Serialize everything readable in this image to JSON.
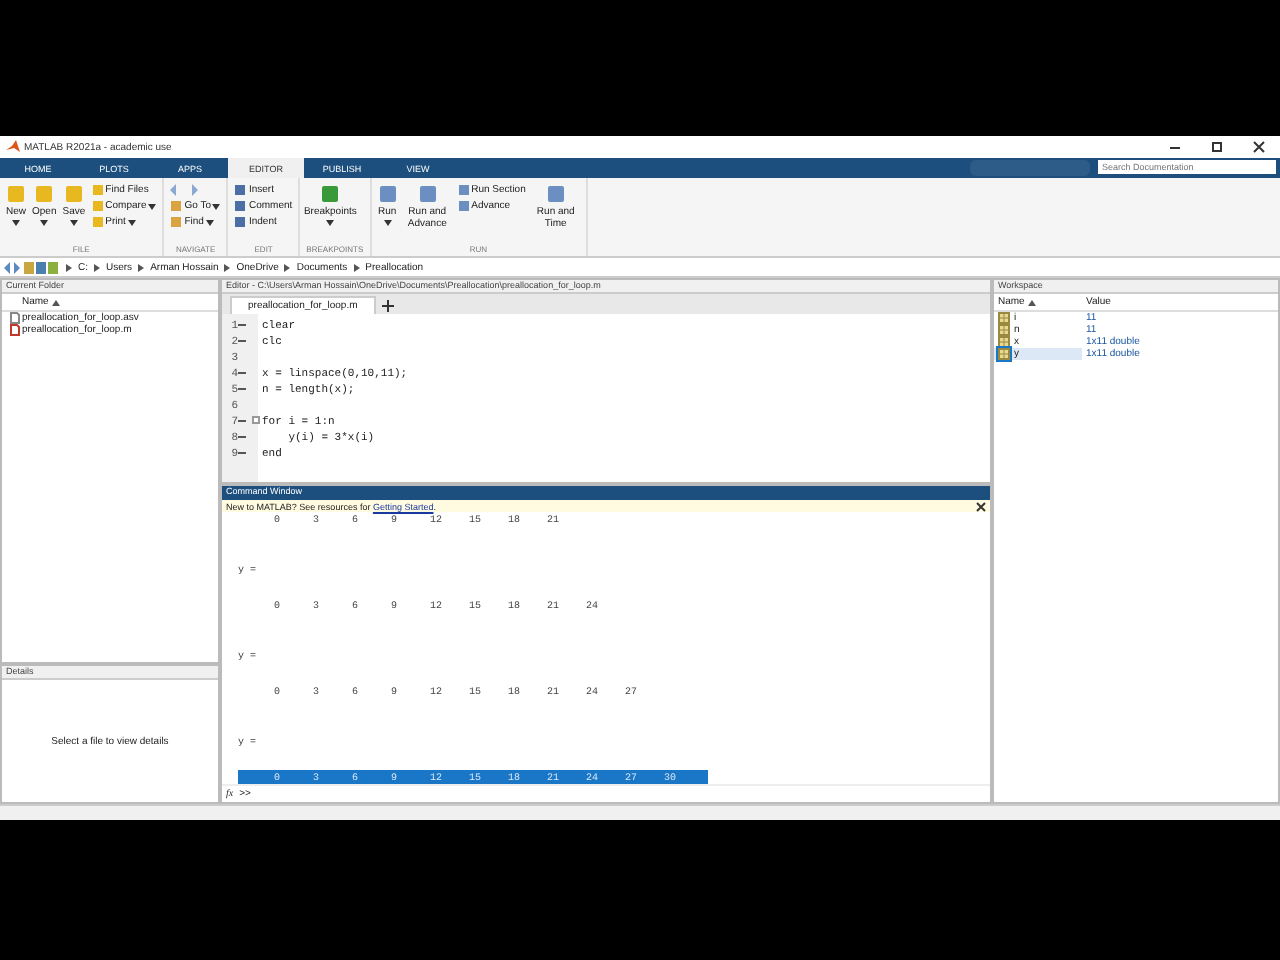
{
  "window": {
    "title": "MATLAB R2021a - academic use"
  },
  "tabs": [
    {
      "label": "HOME",
      "selected": false
    },
    {
      "label": "PLOTS",
      "selected": false
    },
    {
      "label": "APPS",
      "selected": false
    },
    {
      "label": "EDITOR",
      "selected": true
    },
    {
      "label": "PUBLISH",
      "selected": false
    },
    {
      "label": "VIEW",
      "selected": false
    }
  ],
  "search": {
    "placeholder": "Search Documentation"
  },
  "ribbon": [
    {
      "label": "FILE",
      "items": [
        {
          "kind": "large",
          "label": "New",
          "caret": true
        },
        {
          "kind": "large",
          "label": "Open",
          "caret": true
        },
        {
          "kind": "large",
          "label": "Save",
          "caret": true
        },
        {
          "kind": "small",
          "label": "Find Files",
          "caret": false
        },
        {
          "kind": "small",
          "label": "Compare",
          "caret": true
        },
        {
          "kind": "small",
          "label": "Print",
          "caret": true
        }
      ]
    },
    {
      "label": "NAVIGATE",
      "items": [
        {
          "kind": "arrows"
        },
        {
          "kind": "small",
          "label": "Go To",
          "caret": true
        },
        {
          "kind": "small",
          "label": "Find",
          "caret": true
        }
      ]
    },
    {
      "label": "EDIT",
      "items": [
        {
          "kind": "small",
          "label": "Insert",
          "caret": false
        },
        {
          "kind": "small",
          "label": "Comment",
          "caret": false
        },
        {
          "kind": "small",
          "label": "Indent",
          "caret": false
        }
      ]
    },
    {
      "label": "BREAKPOINTS",
      "items": [
        {
          "kind": "large",
          "label": "Breakpoints",
          "caret": true
        }
      ]
    },
    {
      "label": "RUN",
      "items": [
        {
          "kind": "large",
          "label": "Run",
          "caret": true
        },
        {
          "kind": "large",
          "label": "Run and Advance",
          "caret": false
        },
        {
          "kind": "small",
          "label": "Run Section",
          "caret": false
        },
        {
          "kind": "small",
          "label": "Advance",
          "caret": false
        },
        {
          "kind": "large",
          "label": "Run and Time",
          "caret": false
        }
      ]
    }
  ],
  "path": [
    "C:",
    "Users",
    "Arman Hossain",
    "OneDrive",
    "Documents",
    "Preallocation"
  ],
  "current_folder": {
    "title": "Current Folder",
    "column": "Name",
    "files": [
      {
        "name": "preallocation_for_loop.asv",
        "kind": "asv"
      },
      {
        "name": "preallocation_for_loop.m",
        "kind": "m"
      }
    ]
  },
  "details": {
    "title": "Details",
    "message": "Select a file to view details"
  },
  "editor": {
    "title": "Editor - C:\\Users\\Arman Hossain\\OneDrive\\Documents\\Preallocation\\preallocation_for_loop.m",
    "tab": "preallocation_for_loop.m",
    "lines": [
      {
        "number": "1",
        "dash": true,
        "text": "clear",
        "fold": false
      },
      {
        "number": "2",
        "dash": true,
        "text": "clc",
        "fold": false
      },
      {
        "number": "3",
        "dash": false,
        "fold": false
      },
      {
        "number": "4",
        "dash": true,
        "text": "x = linspace(0,10,11);",
        "fold": false
      },
      {
        "number": "5",
        "dash": true,
        "text": "n = length(x);",
        "fold": false
      },
      {
        "number": "6",
        "dash": false,
        "fold": false
      },
      {
        "number": "7",
        "dash": true,
        "text": "for i = 1:n",
        "fold": true
      },
      {
        "number": "8",
        "dash": true,
        "text": "    y(i) = 3*x(i)",
        "fold": false
      },
      {
        "number": "9",
        "dash": true,
        "text": "end",
        "fold": false
      }
    ]
  },
  "command_window": {
    "title": "Command Window",
    "banner": "New to MATLAB? See resources for ",
    "banner_link": "Getting Started",
    "banner_end": ".",
    "output": [
      {
        "kind": "values",
        "values": [
          "0",
          "3",
          "6",
          "9",
          "12",
          "15",
          "18",
          "21"
        ],
        "selected": false
      },
      {
        "kind": "var",
        "text": "y ="
      },
      {
        "kind": "values",
        "values": [
          "0",
          "3",
          "6",
          "9",
          "12",
          "15",
          "18",
          "21",
          "24"
        ],
        "selected": false
      },
      {
        "kind": "var",
        "text": "y ="
      },
      {
        "kind": "values",
        "values": [
          "0",
          "3",
          "6",
          "9",
          "12",
          "15",
          "18",
          "21",
          "24",
          "27"
        ],
        "selected": false
      },
      {
        "kind": "var",
        "text": "y ="
      },
      {
        "kind": "values",
        "values": [
          "0",
          "3",
          "6",
          "9",
          "12",
          "15",
          "18",
          "21",
          "24",
          "27",
          "30"
        ],
        "selected": true
      }
    ],
    "function_browser": "fx",
    "prompt": ">>"
  },
  "workspace": {
    "title": "Workspace",
    "columns": [
      "Name",
      "Value"
    ],
    "variables": [
      {
        "name": "i",
        "value": "11",
        "selected": false
      },
      {
        "name": "n",
        "value": "11",
        "selected": false
      },
      {
        "name": "x",
        "value": "1x11 double",
        "selected": false
      },
      {
        "name": "y",
        "value": "1x11 double",
        "selected": true
      }
    ]
  }
}
